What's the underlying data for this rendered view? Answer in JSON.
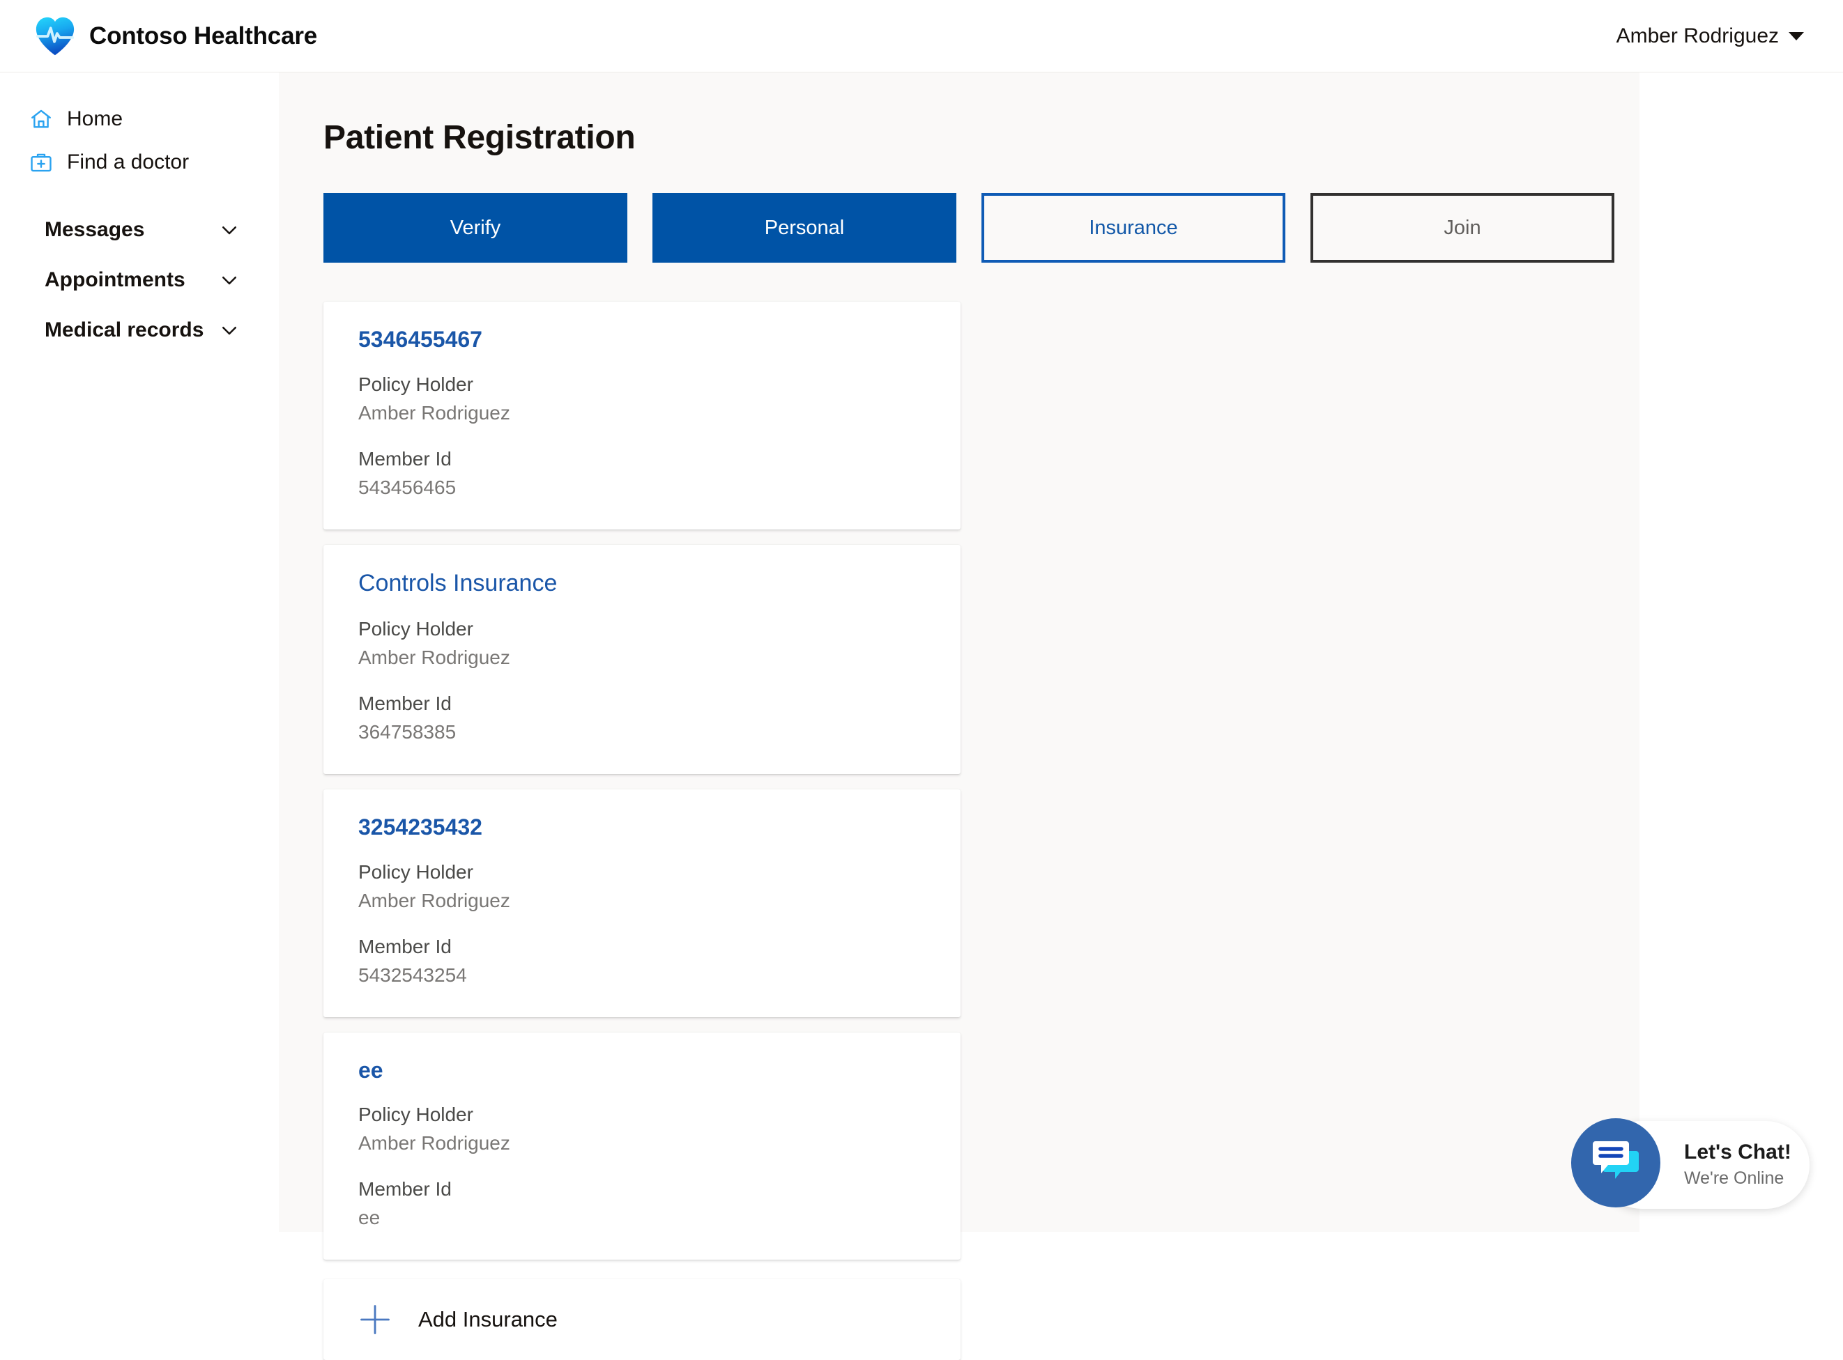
{
  "header": {
    "brand_name": "Contoso Healthcare",
    "logo_icon": "heart-pulse-logo",
    "user_name": "Amber Rodriguez",
    "caret_icon": "caret-down-icon"
  },
  "sidebar": {
    "links": [
      {
        "label": "Home",
        "icon": "home-icon"
      },
      {
        "label": "Find a doctor",
        "icon": "doctor-bag-icon"
      }
    ],
    "groups": [
      {
        "label": "Messages",
        "icon": "chevron-down-icon"
      },
      {
        "label": "Appointments",
        "icon": "chevron-down-icon"
      },
      {
        "label": "Medical records",
        "icon": "chevron-down-icon"
      }
    ]
  },
  "main": {
    "page_title": "Patient Registration",
    "tabs": [
      {
        "label": "Verify",
        "style": "filled"
      },
      {
        "label": "Personal",
        "style": "filled"
      },
      {
        "label": "Insurance",
        "style": "outline-blue"
      },
      {
        "label": "Join",
        "style": "outline-dark"
      }
    ],
    "labels": {
      "policy_holder": "Policy Holder",
      "member_id": "Member Id"
    },
    "cards": [
      {
        "title": "5346455467",
        "title_bold": true,
        "policy_holder_label": "Policy Holder",
        "policy_holder": "Amber Rodriguez",
        "member_id_label": "Member Id",
        "member_id": "543456465"
      },
      {
        "title": "Controls Insurance",
        "title_bold": false,
        "policy_holder_label": "Policy Holder",
        "policy_holder": "Amber Rodriguez",
        "member_id_label": "Member Id",
        "member_id": "364758385"
      },
      {
        "title": "3254235432",
        "title_bold": true,
        "policy_holder_label": "Policy Holder",
        "policy_holder": "Amber Rodriguez",
        "member_id_label": "Member Id",
        "member_id": "5432543254"
      },
      {
        "title": "ee",
        "title_bold": true,
        "policy_holder_label": "Policy Holder",
        "policy_holder": "Amber Rodriguez",
        "member_id_label": "Member Id",
        "member_id": "ee"
      }
    ],
    "add_insurance": {
      "label": "Add Insurance",
      "icon": "plus-icon"
    }
  },
  "chat": {
    "title": "Let's Chat!",
    "status": "We're Online",
    "icon": "chat-bubbles-icon"
  },
  "colors": {
    "primary_blue": "#0053a6",
    "link_blue": "#1a56a8",
    "outline_blue": "#0f5bb5",
    "outline_dark": "#323130",
    "icon_blue": "#2ba3f0",
    "chat_circle": "#3266ad",
    "content_bg": "#faf9f8",
    "card_bg": "#ffffff"
  }
}
